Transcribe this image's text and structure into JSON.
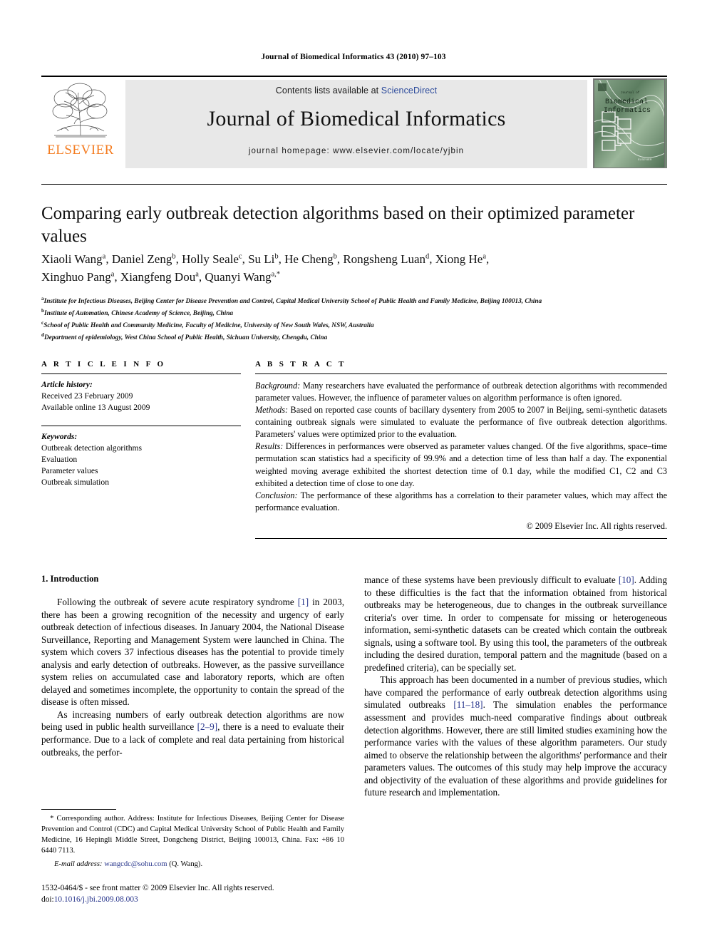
{
  "running_head": "Journal of Biomedical Informatics 43 (2010) 97–103",
  "masthead": {
    "publisher_name": "ELSEVIER",
    "contents_prefix": "Contents lists available at ",
    "contents_link": "ScienceDirect",
    "journal_title": "Journal of Biomedical Informatics",
    "homepage_line": "journal homepage: www.elsevier.com/locate/yjbin",
    "cover_title_line1": "Biomedical",
    "cover_title_line2": "Informatics",
    "cover_kicker": "Journal of"
  },
  "article": {
    "title": "Comparing early outbreak detection algorithms based on their optimized parameter values",
    "authors_line1": "Xiaoli Wang a, Daniel Zeng b, Holly Seale c, Su Li b, He Cheng b, Rongsheng Luan d, Xiong He a,",
    "authors_line2": "Xinghuo Pang a, Xiangfeng Dou a, Quanyi Wang a,*",
    "affiliations": [
      {
        "marker": "a",
        "text": "Institute for Infectious Diseases, Beijing Center for Disease Prevention and Control, Capital Medical University School of Public Health and Family Medicine, Beijing 100013, China"
      },
      {
        "marker": "b",
        "text": "Institute of Automation, Chinese Academy of Science, Beijing, China"
      },
      {
        "marker": "c",
        "text": "School of Public Health and Community Medicine, Faculty of Medicine, University of New South Wales, NSW, Australia"
      },
      {
        "marker": "d",
        "text": "Department of epidemiology, West China School of Public Health, Sichuan University, Chengdu, China"
      }
    ]
  },
  "article_info": {
    "heading": "A R T I C L E   I N F O",
    "history_label": "Article history:",
    "history_lines": [
      "Received 23 February 2009",
      "Available online 13 August 2009"
    ],
    "keywords_label": "Keywords:",
    "keywords": [
      "Outbreak detection algorithms",
      "Evaluation",
      "Parameter values",
      "Outbreak simulation"
    ]
  },
  "abstract": {
    "heading": "A B S T R A C T",
    "sections": [
      {
        "label": "Background:",
        "text": " Many researchers have evaluated the performance of outbreak detection algorithms with recommended parameter values. However, the influence of parameter values on algorithm performance is often ignored."
      },
      {
        "label": "Methods:",
        "text": " Based on reported case counts of bacillary dysentery from 2005 to 2007 in Beijing, semi-synthetic datasets containing outbreak signals were simulated to evaluate the performance of five outbreak detection algorithms. Parameters' values were optimized prior to the evaluation."
      },
      {
        "label": "Results:",
        "text": " Differences in performances were observed as parameter values changed. Of the five algorithms, space–time permutation scan statistics had a specificity of 99.9% and a detection time of less than half a day. The exponential weighted moving average exhibited the shortest detection time of 0.1 day, while the modified C1, C2 and C3 exhibited a detection time of close to one day."
      },
      {
        "label": "Conclusion:",
        "text": " The performance of these algorithms has a correlation to their parameter values, which may affect the performance evaluation."
      }
    ],
    "copyright": "© 2009 Elsevier Inc. All rights reserved."
  },
  "body": {
    "section_number_title": "1. Introduction",
    "left_paragraphs": [
      "Following the outbreak of severe acute respiratory syndrome [1] in 2003, there has been a growing recognition of the necessity and urgency of early outbreak detection of infectious diseases. In January 2004, the National Disease Surveillance, Reporting and Management System were launched in China. The system which covers 37 infectious diseases has the potential to provide timely analysis and early detection of outbreaks. However, as the passive surveillance system relies on accumulated case and laboratory reports, which are often delayed and sometimes incomplete, the opportunity to contain the spread of the disease is often missed.",
      "As increasing numbers of early outbreak detection algorithms are now being used in public health surveillance [2–9], there is a need to evaluate their performance. Due to a lack of complete and real data pertaining from historical outbreaks, the perfor-"
    ],
    "right_paragraphs": [
      "mance of these systems have been previously difficult to evaluate [10]. Adding to these difficulties is the fact that the information obtained from historical outbreaks may be heterogeneous, due to changes in the outbreak surveillance criteria's over time. In order to compensate for missing or heterogeneous information, semi-synthetic datasets can be created which contain the outbreak signals, using a software tool. By using this tool, the parameters of the outbreak including the desired duration, temporal pattern and the magnitude (based on a predefined criteria), can be specially set.",
      "This approach has been documented in a number of previous studies, which have compared the performance of early outbreak detection algorithms using simulated outbreaks [11–18]. The simulation enables the performance assessment and provides much-need comparative findings about outbreak detection algorithms. However, there are still limited studies examining how the performance varies with the values of these algorithm parameters. Our study aimed to observe the relationship between the algorithms' performance and their parameters values. The outcomes of this study may help improve the accuracy and objectivity of the evaluation of these algorithms and provide guidelines for future research and implementation."
    ]
  },
  "footnote": {
    "corresponding": "Corresponding author. Address: Institute for Infectious Diseases, Beijing Center for Disease Prevention and Control (CDC) and Capital Medical University School of Public Health and Family Medicine, 16 Hepingli Middle Street, Dongcheng District, Beijing 100013, China. Fax: +86 10 6440 7113.",
    "email_label": "E-mail address:",
    "email": "wangcdc@sohu.com",
    "email_owner": "(Q. Wang)."
  },
  "imprint": {
    "issn_line": "1532-0464/$ - see front matter © 2009 Elsevier Inc. All rights reserved.",
    "doi_label": "doi:",
    "doi": "10.1016/j.jbi.2009.08.003"
  },
  "colors": {
    "elsevier_orange": "#F47C20",
    "link_blue": "#26348b",
    "sciencedirect_blue": "#2b4a9b",
    "band_gray": "#e8e8e8"
  }
}
